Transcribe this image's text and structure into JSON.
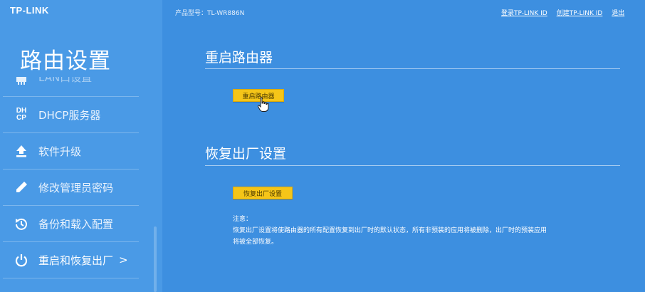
{
  "brand": {
    "logo_text": "TP-LINK"
  },
  "header": {
    "model_label": "产品型号：TL-WR886N",
    "links": [
      "登录TP-LINK ID",
      "创建TP-LINK ID",
      "退出"
    ]
  },
  "sidebar": {
    "title": "路由设置",
    "items": [
      {
        "label": "LAN口设置",
        "icon": "lan-icon"
      },
      {
        "label": "DHCP服务器",
        "icon": "dhcp-icon"
      },
      {
        "label": "软件升级",
        "icon": "upgrade-icon"
      },
      {
        "label": "修改管理员密码",
        "icon": "pencil-icon"
      },
      {
        "label": "备份和载入配置",
        "icon": "restore-icon"
      },
      {
        "label": "重启和恢复出厂",
        "icon": "power-icon",
        "chevron": ">"
      }
    ]
  },
  "main": {
    "reboot": {
      "title": "重启路由器",
      "button_label": "重启路由器"
    },
    "factory": {
      "title": "恢复出厂设置",
      "button_label": "恢复出厂设置",
      "notice_title": "注意：",
      "notice_lines": [
        "恢复出厂设置将使路由器的所有配置恢复到出厂时的默认状态，所有非预装的应用将被删除，出厂时的预装应用",
        "将被全部恢复。"
      ]
    }
  },
  "colors": {
    "background": "#3d8fe0",
    "sidebar": "#4a9ae6",
    "button": "#f5c518"
  }
}
